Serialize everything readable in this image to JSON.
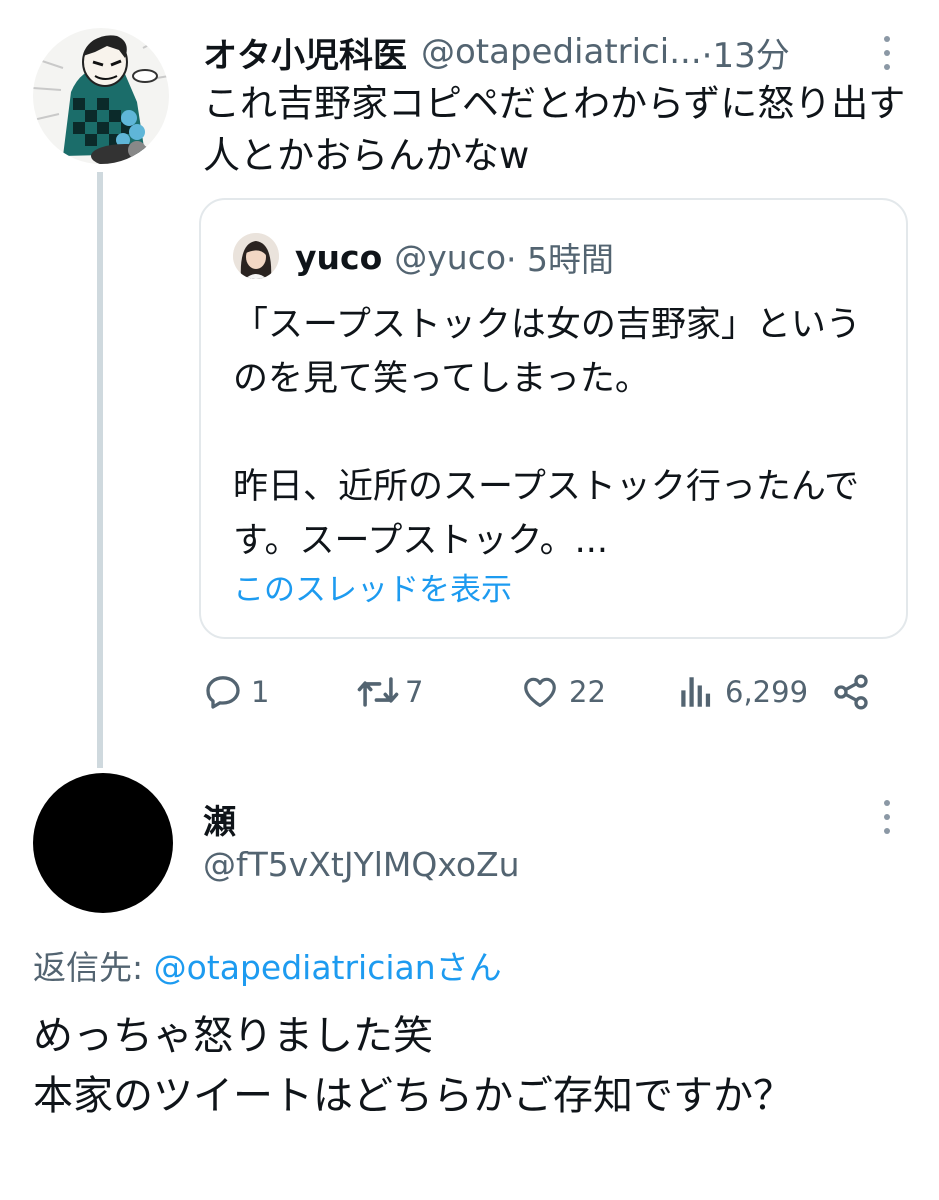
{
  "parent_tweet": {
    "display_name": "オタ小児科医",
    "handle": "@otapediatrici...",
    "time": "·13分",
    "text": "これ吉野家コピペだとわからずに怒り出す人とかおらんかなw",
    "more_icon": "more-vertical-icon",
    "quoted_tweet": {
      "display_name": "yuco",
      "handle": "@yuco",
      "time": "· 5時間",
      "paragraph_1": "「スープストックは女の吉野家」というのを見て笑ってしまった。",
      "paragraph_2": "昨日、近所のスープストック行ったんです。スープストック。...",
      "show_thread_link": "このスレッドを表示"
    },
    "actions": {
      "reply": {
        "icon": "reply-icon",
        "count": "1"
      },
      "retweet": {
        "icon": "retweet-icon",
        "count": "7"
      },
      "like": {
        "icon": "heart-icon",
        "count": "22"
      },
      "views": {
        "icon": "views-icon",
        "count": "6,299"
      },
      "share": {
        "icon": "share-icon"
      }
    }
  },
  "reply_tweet": {
    "display_name": "瀬",
    "handle": "@fT5vXtJYlMQxoZu",
    "more_icon": "more-vertical-icon",
    "replying_to_label": "返信先: ",
    "replying_to_mention": "@otapediatricianさん",
    "line_1": "めっちゃ怒りました笑",
    "line_2": "本家のツイートはどちらかご存知ですか？"
  },
  "colors": {
    "text_primary": "#0f1419",
    "text_secondary": "#536471",
    "link": "#1d9bf0",
    "thread_line": "#cfd9de",
    "card_border": "#e3e8eb"
  }
}
